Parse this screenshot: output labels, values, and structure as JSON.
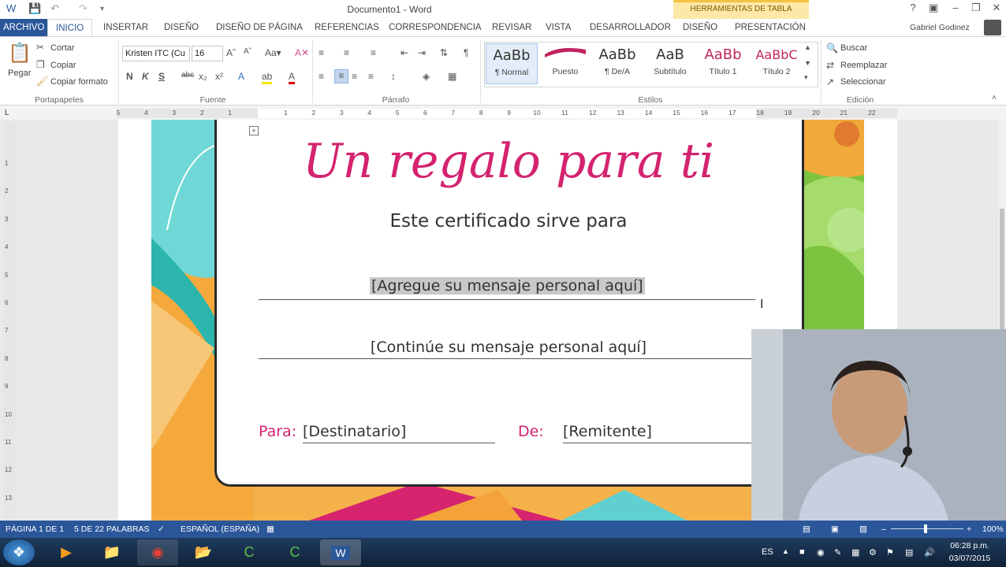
{
  "window": {
    "title": "Documento1 - Word",
    "tools_band": "HERRAMIENTAS DE TABLA",
    "help": "?",
    "user": "Gabriel Godinez"
  },
  "tabs": [
    "ARCHIVO",
    "INICIO",
    "INSERTAR",
    "DISEÑO",
    "DISEÑO DE PÁGINA",
    "REFERENCIAS",
    "CORRESPONDENCIA",
    "REVISAR",
    "VISTA",
    "DESARROLLADOR",
    "DISEÑO",
    "PRESENTACIÓN"
  ],
  "ribbon": {
    "clipboard": {
      "paste": "Pegar",
      "cut": "Cortar",
      "copy": "Copiar",
      "format_painter": "Copiar formato",
      "label": "Portapapeles"
    },
    "font": {
      "name": "Kristen ITC (Cu",
      "size": "16",
      "label": "Fuente"
    },
    "paragraph": {
      "label": "Párrafo"
    },
    "styles": {
      "items": [
        {
          "preview": "AaBb",
          "name": "¶ Normal"
        },
        {
          "preview": "",
          "name": "Puesto"
        },
        {
          "preview": "AaBb",
          "name": "¶ De/A"
        },
        {
          "preview": "AaB",
          "name": "Subtítulo"
        },
        {
          "preview": "AaBb",
          "name": "Título 1"
        },
        {
          "preview": "AaBbC",
          "name": "Título 2"
        }
      ],
      "label": "Estilos"
    },
    "editing": {
      "find": "Buscar",
      "replace": "Reemplazar",
      "select": "Seleccionar",
      "label": "Edición"
    }
  },
  "ruler": {
    "ticks": [
      "5",
      "4",
      "3",
      "2",
      "1",
      "1",
      "2",
      "3",
      "4",
      "5",
      "6",
      "7",
      "8",
      "9",
      "10",
      "11",
      "12",
      "13",
      "14",
      "15",
      "16",
      "17",
      "18",
      "19",
      "20",
      "21",
      "22"
    ],
    "vticks": [
      "1",
      "2",
      "3",
      "4",
      "5",
      "6",
      "7",
      "8",
      "9",
      "10",
      "11",
      "12",
      "13"
    ]
  },
  "certificate": {
    "title": "Un regalo para ti",
    "subtitle": "Este certificado sirve para",
    "message1": "[Agregue su mensaje personal aquí]",
    "message2": "[Continúe su mensaje personal aquí]",
    "to_label": "Para:",
    "to_value": "[Destinatario]",
    "from_label": "De:",
    "from_value": "[Remitente]"
  },
  "status": {
    "page": "PÁGINA 1 DE 1",
    "words": "5 DE 22 PALABRAS",
    "language": "ESPAÑOL (ESPAÑA)",
    "zoom": "100%"
  },
  "taskbar": {
    "lang": "ES",
    "time": "06:28 p.m.",
    "date": "03/07/2015"
  },
  "colors": {
    "accent": "#2b579a",
    "title_pink": "#d4236f"
  }
}
